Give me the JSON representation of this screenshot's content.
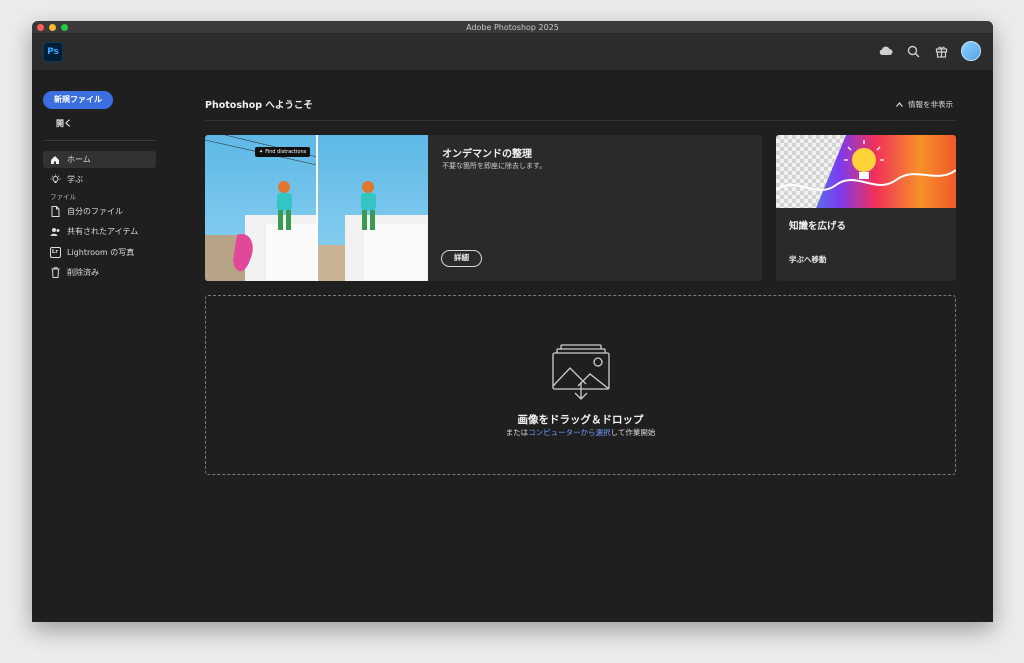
{
  "window": {
    "title": "Adobe Photoshop 2025"
  },
  "app": {
    "logo_text": "Ps"
  },
  "sidebar": {
    "new_file_label": "新規ファイル",
    "open_label": "開く",
    "section_files": "ファイル",
    "items": [
      {
        "label": "ホーム",
        "icon": "home-icon"
      },
      {
        "label": "学ぶ",
        "icon": "lightbulb-icon"
      },
      {
        "label": "自分のファイル",
        "icon": "document-icon"
      },
      {
        "label": "共有されたアイテム",
        "icon": "people-icon"
      },
      {
        "label": "Lightroom の写真",
        "icon": "lightroom-icon"
      },
      {
        "label": "削除済み",
        "icon": "trash-icon"
      }
    ],
    "lightroom_badge": "Lr"
  },
  "main": {
    "welcome": "Photoshop へようこそ",
    "hide_info": "情報を非表示"
  },
  "promo_card": {
    "title": "オンデマンドの整理",
    "subtitle": "不要な箇所を即座に除去します。",
    "button": "詳細",
    "image_tag": "Find distractions"
  },
  "learn_card": {
    "title": "知識を広げる",
    "link": "学ぶへ移動"
  },
  "dropzone": {
    "title": "画像をドラッグ＆ドロップ",
    "sub_prefix": "または",
    "sub_link": "コンピューターから選択",
    "sub_suffix": "して作業開始"
  },
  "colors": {
    "accent": "#3b6fe0",
    "link": "#6d9cff",
    "background": "#1f1f1f"
  }
}
